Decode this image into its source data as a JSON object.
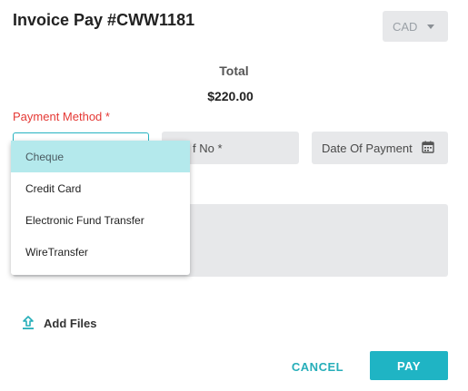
{
  "dialog": {
    "title": "Invoice Pay #CWW1181",
    "currency": {
      "selected": "CAD",
      "icon": "caret-down-icon"
    },
    "total": {
      "label": "Total",
      "value": "$220.00"
    },
    "payment_method": {
      "label": "Payment Method *",
      "options": [
        "Cheque",
        "Credit Card",
        "Electronic Fund Transfer",
        "WireTransfer"
      ],
      "highlighted": "Cheque"
    },
    "reference": {
      "placeholder_partial": "f No *"
    },
    "date": {
      "placeholder": "Date Of Payment",
      "icon": "calendar-icon"
    },
    "add_files": {
      "label": "Add Files",
      "icon": "upload-icon"
    },
    "actions": {
      "cancel": "CANCEL",
      "pay": "PAY"
    }
  },
  "colors": {
    "accent": "#1fb4c4",
    "required": "#e53935",
    "field_bg": "#e7e8ea",
    "option_highlight": "#b4e9ec"
  }
}
